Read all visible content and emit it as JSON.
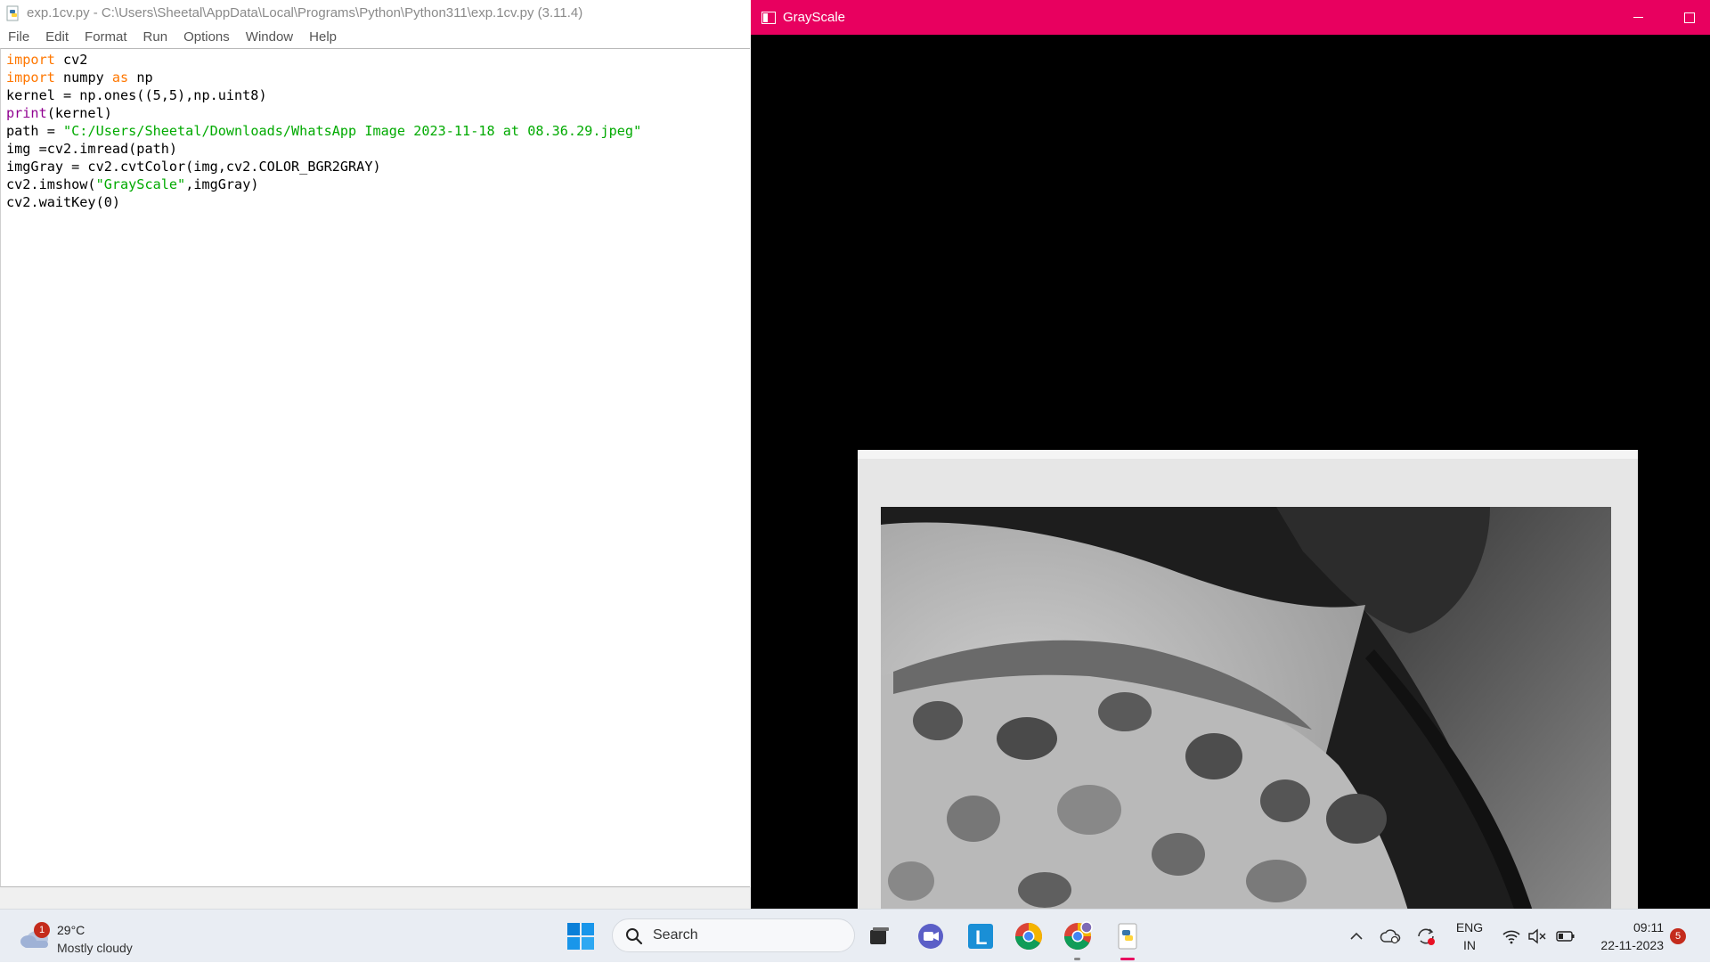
{
  "idle": {
    "title": "exp.1cv.py - C:\\Users\\Sheetal\\AppData\\Local\\Programs\\Python\\Python311\\exp.1cv.py (3.11.4)",
    "menu": [
      "File",
      "Edit",
      "Format",
      "Run",
      "Options",
      "Window",
      "Help"
    ],
    "code": {
      "l1_kw": "import",
      "l1_rest": " cv2",
      "l2_kw": "import",
      "l2_mid": " numpy ",
      "l2_kw2": "as",
      "l2_rest": " np",
      "l3": "kernel = np.ones((5,5),np.uint8)",
      "l4_bi": "print",
      "l4_rest": "(kernel)",
      "l5_pre": "path = ",
      "l5_str": "\"C:/Users/Sheetal/Downloads/WhatsApp Image 2023-11-18 at 08.36.29.jpeg\"",
      "l6": "img =cv2.imread(path)",
      "l7": "imgGray = cv2.cvtColor(img,cv2.COLOR_BGR2GRAY)",
      "l8_pre": "cv2.imshow(",
      "l8_str": "\"GrayScale\"",
      "l8_rest": ",imgGray)",
      "l9": "cv2.waitKey(0)"
    }
  },
  "grayscale_window": {
    "title": "GrayScale",
    "accent_color": "#e8005f"
  },
  "taskbar": {
    "weather": {
      "temp": "29°C",
      "desc": "Mostly cloudy",
      "badge": "1"
    },
    "search_placeholder": "Search",
    "apps": [
      "task-view",
      "teams-meet",
      "l-app",
      "chrome",
      "chrome-profile",
      "idle-python"
    ],
    "tray": {
      "lang_line1": "ENG",
      "lang_line2": "IN",
      "time": "09:11",
      "date": "22-11-2023",
      "notifications": "5"
    }
  }
}
